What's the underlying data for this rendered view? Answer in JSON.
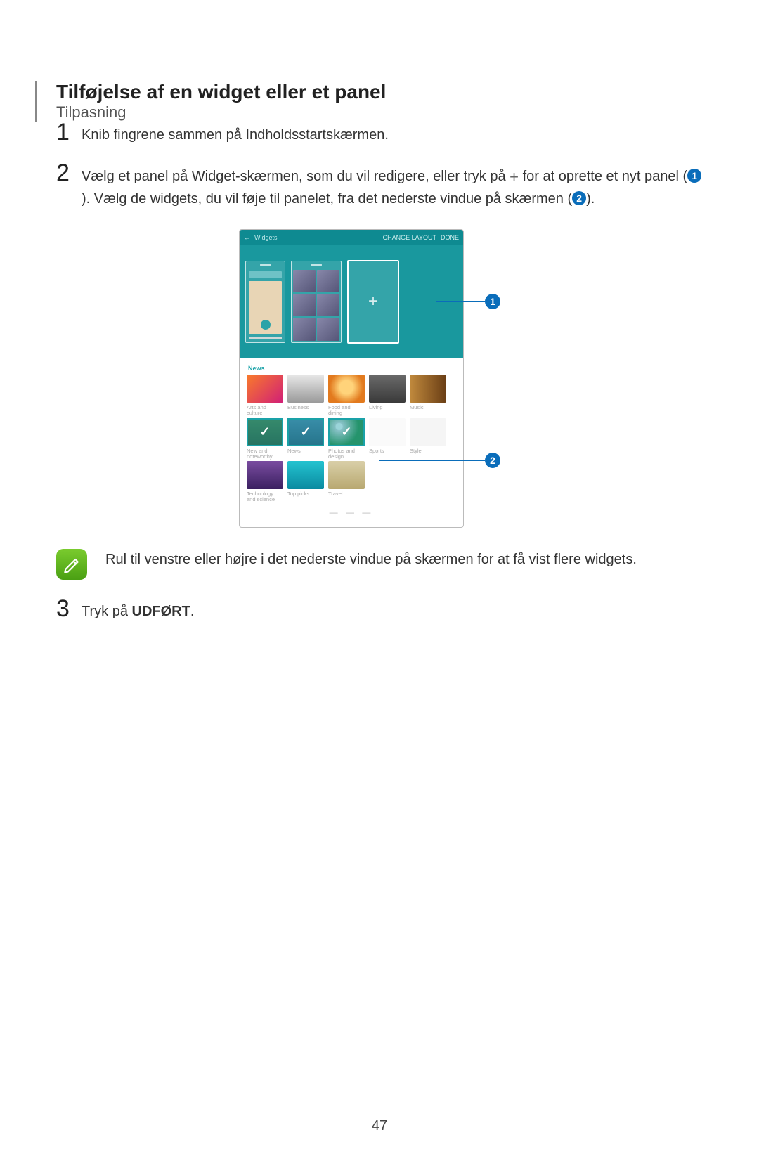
{
  "breadcrumb": "Tilpasning",
  "title": "Tilføjelse af en widget eller et panel",
  "steps": [
    {
      "num": "1",
      "text": "Knib fingrene sammen på Indholdsstartskærmen."
    },
    {
      "num": "2",
      "part1": "Vælg et panel på Widget-skærmen, som du vil redigere, eller tryk på ",
      "plus": "+",
      "part2": " for at oprette et nyt panel (",
      "bullet1": "1",
      "part3": "). Vælg de widgets, du vil føje til panelet, fra det nederste vindue på skærmen (",
      "bullet2": "2",
      "part4": ")."
    },
    {
      "num": "3",
      "prefix": "Tryk på ",
      "boldword": "UDFØRT",
      "suffix": "."
    }
  ],
  "note": "Rul til venstre eller højre i det nederste vindue på skærmen for at få vist flere widgets.",
  "page_number": "47",
  "device": {
    "topbar": {
      "back": "←",
      "title": "Widgets",
      "right1": "CHANGE LAYOUT",
      "right2": "DONE"
    },
    "callout1": "1",
    "callout2": "2",
    "news_label": "News",
    "widget_rows": [
      [
        {
          "cls": "c1",
          "cap": "Arts and culture"
        },
        {
          "cls": "c2",
          "cap": "Business"
        },
        {
          "cls": "c3",
          "cap": "Food and dining"
        },
        {
          "cls": "c4",
          "cap": "Living"
        },
        {
          "cls": "c5",
          "cap": "Music"
        }
      ],
      [
        {
          "cls": "c6",
          "cap": "New and noteworthy",
          "selected": true
        },
        {
          "cls": "c7",
          "cap": "News",
          "selected": true
        },
        {
          "cls": "c8",
          "cap": "Photos and design",
          "selected": true
        },
        {
          "cls": "c9",
          "cap": "Sports"
        },
        {
          "cls": "c10",
          "cap": "Style"
        }
      ],
      [
        {
          "cls": "c11",
          "cap": "Technology and science"
        },
        {
          "cls": "c12",
          "cap": "Top picks"
        },
        {
          "cls": "c13",
          "cap": "Travel"
        }
      ]
    ]
  }
}
